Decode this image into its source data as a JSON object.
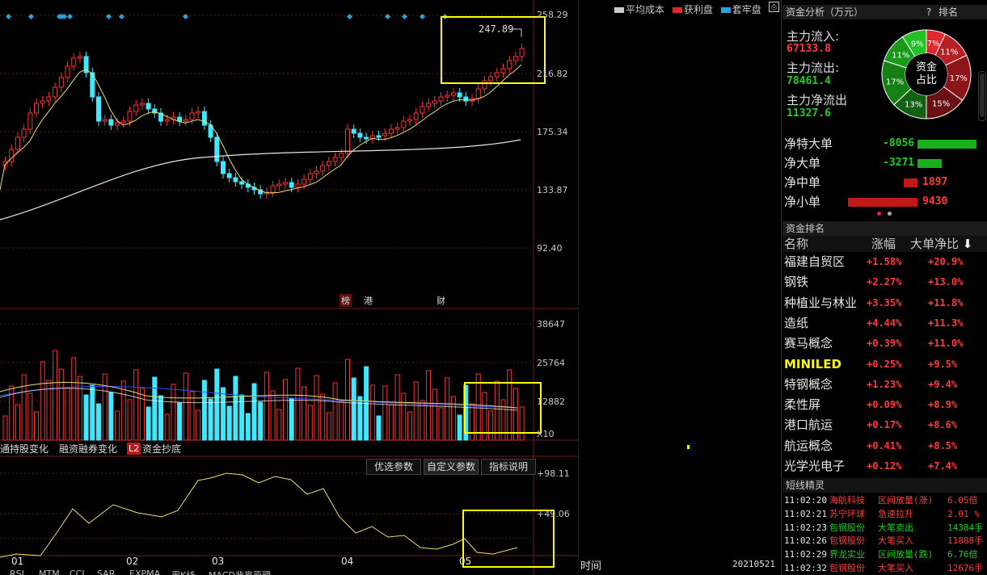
{
  "legend": {
    "avg_cost": "平均成本",
    "profit": "获利盘",
    "trapped": "套牢盘"
  },
  "price_axis": [
    "258.29",
    "216.82",
    "175.34",
    "133.87",
    "92.40"
  ],
  "price_axis_colors": [
    "#ff3c3c",
    "#ff3c3c",
    "#ff3c3c",
    "#ff3c3c",
    "#ff3c3c"
  ],
  "peak_price": "247.89",
  "event_marks": [
    "榜",
    "港",
    "财"
  ],
  "volume_axis": [
    "38647",
    "25764",
    "12882",
    "X10"
  ],
  "sub_tabs": [
    "通持股变化",
    "融资融券变化",
    "L2",
    "资金抄底"
  ],
  "osc_buttons": [
    "优选参数",
    "自定义参数",
    "指标说明"
  ],
  "osc_axis": [
    "+98.11",
    "+49.06"
  ],
  "months": [
    "01",
    "02",
    "03",
    "04",
    "05"
  ],
  "bottom_tabs": [
    "RSI",
    "MTM",
    "CCI",
    "SAR",
    "EXPMA",
    "周K线",
    "MACD背离原理"
  ],
  "chips": {
    "time_label": "时间",
    "date": "20210521"
  },
  "fund": {
    "title": "资金分析（万元）",
    "help": "?",
    "rank_link": "排名",
    "inflow_label": "主力流入:",
    "inflow": "67133.8",
    "outflow_label": "主力流出:",
    "outflow": "78461.4",
    "net_label": "主力净流出",
    "net": "11327.6",
    "donut_center": [
      "资金",
      "占比"
    ],
    "donut": [
      {
        "label": "7%",
        "value": 7,
        "color": "#e0282e"
      },
      {
        "label": "11%",
        "value": 11,
        "color": "#b81f24"
      },
      {
        "label": "17%",
        "value": 17,
        "color": "#8c1519"
      },
      {
        "label": "15%",
        "value": 15,
        "color": "#6a0f12"
      },
      {
        "label": "13%",
        "value": 13,
        "color": "#126012"
      },
      {
        "label": "17%",
        "value": 17,
        "color": "#168016"
      },
      {
        "label": "11%",
        "value": 11,
        "color": "#1a9a1a"
      },
      {
        "label": "9%",
        "value": 9,
        "color": "#22c022"
      }
    ],
    "bars": [
      {
        "label": "净特大单",
        "value": "-8056",
        "amount": -8056
      },
      {
        "label": "净大单",
        "value": "-3271",
        "amount": -3271
      },
      {
        "label": "净中单",
        "value": "1897",
        "amount": 1897
      },
      {
        "label": "净小单",
        "value": "9430",
        "amount": 9430
      }
    ]
  },
  "ranking": {
    "title": "资金排名",
    "headers": [
      "名称",
      "涨幅",
      "大单净比"
    ],
    "rows": [
      {
        "name": "福建自贸区",
        "chg": "+1.58%",
        "ratio": "+20.9%"
      },
      {
        "name": "钢铁",
        "chg": "+2.27%",
        "ratio": "+13.0%"
      },
      {
        "name": "种植业与林业",
        "chg": "+3.35%",
        "ratio": "+11.8%"
      },
      {
        "name": "造纸",
        "chg": "+4.44%",
        "ratio": "+11.3%"
      },
      {
        "name": "赛马概念",
        "chg": "+0.39%",
        "ratio": "+11.0%"
      },
      {
        "name": "MINILED",
        "chg": "+0.25%",
        "ratio": "+9.5%"
      },
      {
        "name": "特钢概念",
        "chg": "+1.23%",
        "ratio": "+9.4%"
      },
      {
        "name": "柔性屏",
        "chg": "+0.09%",
        "ratio": "+8.9%"
      },
      {
        "name": "港口航运",
        "chg": "+0.17%",
        "ratio": "+8.6%"
      },
      {
        "name": "航运概念",
        "chg": "+0.41%",
        "ratio": "+8.5%"
      },
      {
        "name": "光学光电子",
        "chg": "+0.12%",
        "ratio": "+7.4%"
      }
    ]
  },
  "shortline": {
    "title": "短线精灵",
    "rows": [
      {
        "time": "11:02:20",
        "name": "海航科技",
        "event": "区间放量(涨)",
        "val": "6.05倍",
        "up": true
      },
      {
        "time": "11:02:21",
        "name": "苏宁环球",
        "event": "急速拉升",
        "val": "2.01 %",
        "up": true
      },
      {
        "time": "11:02:23",
        "name": "包钢股份",
        "event": "大笔卖出",
        "val": "14384手",
        "up": false
      },
      {
        "time": "11:02:26",
        "name": "包钢股份",
        "event": "大笔买入",
        "val": "11888手",
        "up": true
      },
      {
        "time": "11:02:29",
        "name": "界龙实业",
        "event": "区间放量(跌)",
        "val": "6.76倍",
        "up": false
      },
      {
        "time": "11:02:32",
        "name": "包钢股份",
        "event": "大笔买入",
        "val": "12676手",
        "up": true
      }
    ]
  }
}
